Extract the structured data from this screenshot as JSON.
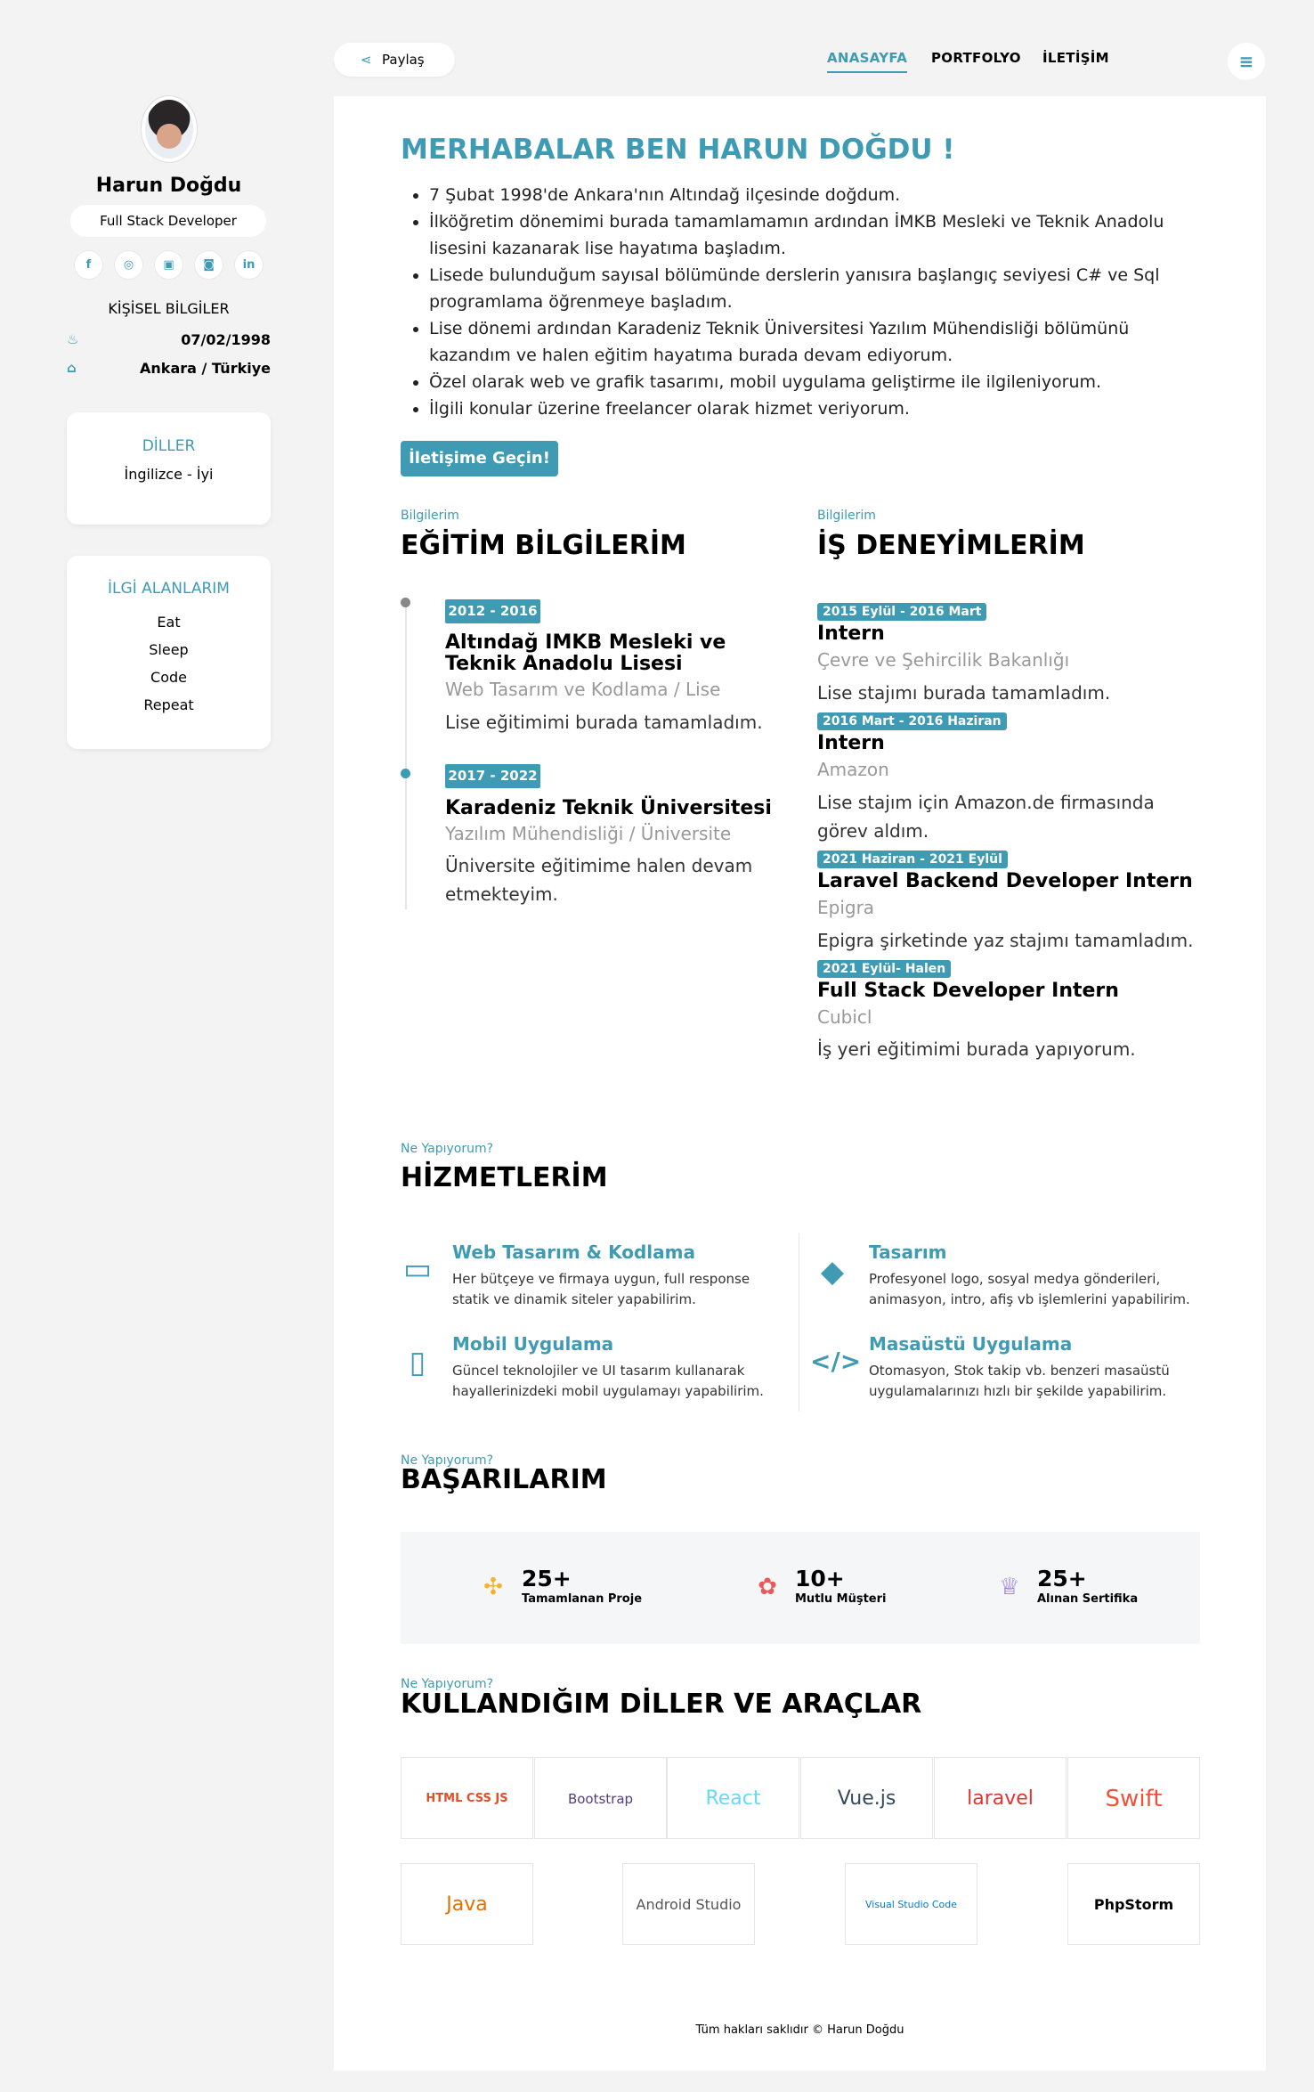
{
  "profile": {
    "name": "Harun Doğdu",
    "title": "Full Stack Developer",
    "socials": [
      "facebook-icon",
      "github-icon",
      "twitter-icon",
      "instagram-icon",
      "linkedin-icon"
    ],
    "personal_heading": "KİŞİSEL BİLGİLER",
    "birth_date": "07/02/1998",
    "location": "Ankara / Türkiye"
  },
  "languages": {
    "heading": "DİLLER",
    "items": [
      "İngilizce - İyi"
    ]
  },
  "interests": {
    "heading": "İLGİ ALANLARIM",
    "items": [
      "Eat",
      "Sleep",
      "Code",
      "Repeat"
    ]
  },
  "topbar": {
    "share_label": "Paylaş",
    "nav": [
      "ANASAYFA",
      "PORTFOLYO",
      "İLETİŞİM"
    ]
  },
  "intro": {
    "heading": "MERHABALAR BEN HARUN DOĞDU !",
    "bullets": [
      "7 Şubat 1998'de Ankara'nın Altındağ ilçesinde doğdum.",
      "İlköğretim dönemimi burada tamamlamamın ardından İMKB Mesleki ve Teknik Anadolu lisesini kazanarak lise hayatıma başladım.",
      "Lisede bulunduğum sayısal bölümünde derslerin yanısıra başlangıç seviyesi C# ve Sql programlama öğrenmeye başladım.",
      "Lise dönemi ardından Karadeniz Teknik Üniversitesi Yazılım Mühendisliği bölümünü kazandım ve halen eğitim hayatıma burada devam ediyorum.",
      "Özel olarak web ve grafik tasarımı, mobil uygulama geliştirme ile ilgileniyorum.",
      "İlgili konular üzerine freelancer olarak hizmet veriyorum."
    ],
    "cta": "İletişime Geçin!"
  },
  "education": {
    "eyebrow": "Bilgilerim",
    "heading": "EĞİTİM BİLGİLERİM",
    "items": [
      {
        "years": "2012 - 2016",
        "school": "Altındağ IMKB Mesleki ve Teknik Anadolu Lisesi",
        "field": "Web Tasarım ve Kodlama / Lise",
        "desc": "Lise eğitimimi burada tamamladım."
      },
      {
        "years": "2017 - 2022",
        "school": "Karadeniz Teknik Üniversitesi",
        "field": "Yazılım Mühendisliği / Üniversite",
        "desc": "Üniversite eğitimime halen devam etmekteyim."
      }
    ]
  },
  "experience": {
    "eyebrow": "Bilgilerim",
    "heading": "İŞ DENEYİMLERİM",
    "items": [
      {
        "dates": "2015 Eylül - 2016 Mart",
        "role": "Intern",
        "company": "Çevre ve Şehircilik Bakanlığı",
        "desc": "Lise stajımı burada tamamladım."
      },
      {
        "dates": "2016 Mart - 2016 Haziran",
        "role": "Intern",
        "company": "Amazon",
        "desc": "Lise stajım için Amazon.de firmasında görev aldım."
      },
      {
        "dates": "2021 Haziran - 2021 Eylül",
        "role": "Laravel Backend Developer Intern",
        "company": "Epigra",
        "desc": "Epigra şirketinde yaz stajımı tamamladım."
      },
      {
        "dates": "2021 Eylül- Halen",
        "role": "Full Stack Developer Intern",
        "company": "Cubicl",
        "desc": "İş yeri eğitimimi burada yapıyorum."
      }
    ]
  },
  "services": {
    "eyebrow": "Ne Yapıyorum?",
    "heading": "HİZMETLERİM",
    "items": [
      {
        "icon": "laptop-icon",
        "title": "Web Tasarım & Kodlama",
        "desc": "Her bütçeye ve firmaya uygun, full response statik ve dinamik siteler yapabilirim."
      },
      {
        "icon": "diamond-icon",
        "title": "Tasarım",
        "desc": "Profesyonel logo, sosyal medya gönderileri, animasyon, intro, afiş vb işlemlerini yapabilirim."
      },
      {
        "icon": "mobile-icon",
        "title": "Mobil Uygulama",
        "desc": "Güncel teknolojiler ve UI tasarım kullanarak hayallerinizdeki mobil uygulamayı yapabilirim."
      },
      {
        "icon": "code-icon",
        "title": "Masaüstü Uygulama",
        "desc": "Otomasyon, Stok takip vb. benzeri masaüstü uygulamalarınızı hızlı bir şekilde yapabilirim."
      }
    ]
  },
  "achievements": {
    "eyebrow": "Ne Yapıyorum?",
    "heading": "BAŞARILARIM",
    "items": [
      {
        "icon": "puzzle-icon",
        "color": "#f2b233",
        "value": "25+",
        "label": "Tamamlanan Proje"
      },
      {
        "icon": "users-icon",
        "color": "#e8595a",
        "value": "10+",
        "label": "Mutlu Müşteri"
      },
      {
        "icon": "trophy-icon",
        "color": "#8a63d2",
        "value": "25+",
        "label": "Alınan Sertifika"
      }
    ]
  },
  "tools": {
    "eyebrow": "Ne Yapıyorum?",
    "heading": "KULLANDIĞIM DİLLER VE ARAÇLAR",
    "items": [
      "HTML CSS JS",
      "Bootstrap",
      "React",
      "Vue.js",
      "laravel",
      "Swift",
      "Java",
      "Android Studio",
      "Visual Studio Code",
      "PhpStorm"
    ]
  },
  "footer": "Tüm hakları saklıdır © Harun Doğdu",
  "colors": {
    "accent": "#3f9ab3",
    "background": "#f3f3f3"
  }
}
